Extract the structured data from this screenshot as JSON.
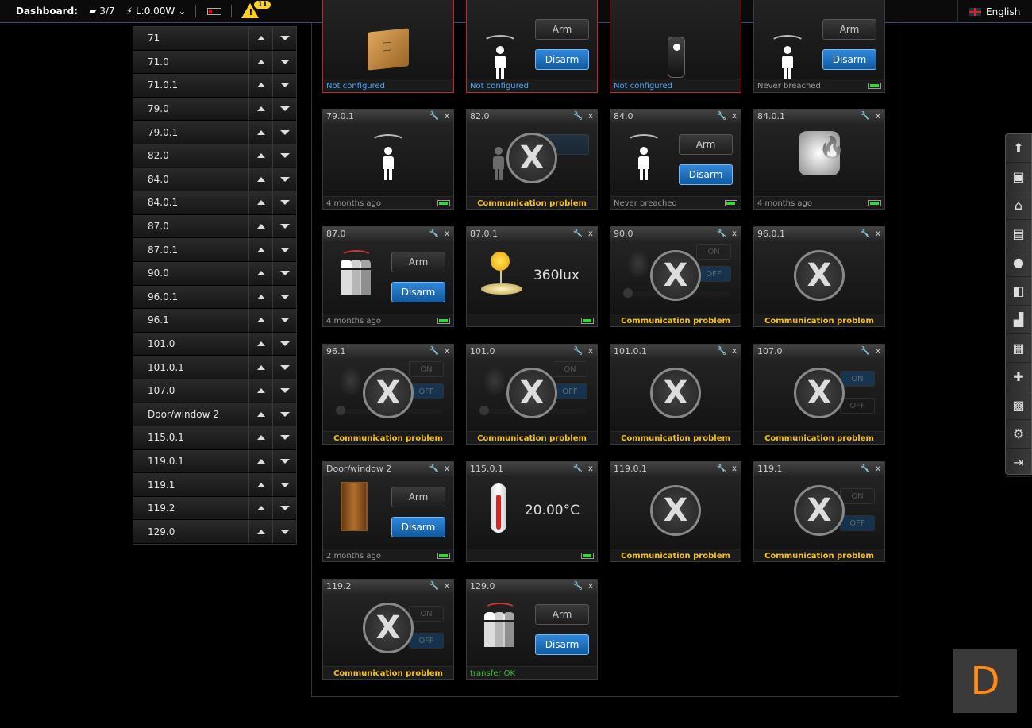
{
  "topbar": {
    "title": "Dashboard:",
    "devices_count": "3/7",
    "power": "L:0.00W",
    "alerts_count": "11",
    "language": "English"
  },
  "sidebar": {
    "items": [
      "71",
      "71.0",
      "71.0.1",
      "79.0",
      "79.0.1",
      "82.0",
      "84.0",
      "84.0.1",
      "87.0",
      "87.0.1",
      "90.0",
      "96.0.1",
      "96.1",
      "101.0",
      "101.0.1",
      "107.0",
      "Door/window 2",
      "115.0.1",
      "119.0.1",
      "119.1",
      "119.2",
      "129.0"
    ]
  },
  "labels": {
    "arm": "Arm",
    "disarm": "Disarm",
    "on": "ON",
    "off": "OFF",
    "x": "X",
    "comm_problem": "Communication problem",
    "not_configured": "Not configured",
    "never_breached": "Never breached",
    "four_months": "4 months ago",
    "two_months": "2 months ago",
    "transfer_ok": "transfer OK",
    "lux": "360lux",
    "temp": "20.00°C"
  },
  "tiles": {
    "r1c4": "",
    "r2c1": "79.0.1",
    "r2c2": "82.0",
    "r2c3": "84.0",
    "r2c4": "84.0.1",
    "r3c1": "87.0",
    "r3c2": "87.0.1",
    "r3c3": "90.0",
    "r3c4": "96.0.1",
    "r4c1": "96.1",
    "r4c2": "101.0",
    "r4c3": "101.0.1",
    "r4c4": "107.0",
    "r5c1": "Door/window 2",
    "r5c2": "115.0.1",
    "r5c3": "119.0.1",
    "r5c4": "119.1",
    "r6c1": "119.2",
    "r6c2": "129.0"
  },
  "logo_letter": "D",
  "colors": {
    "accent": "#2f88dd",
    "alert_border": "#c0262b",
    "warning": "#f3c11a",
    "ok": "#3cbf3c"
  }
}
